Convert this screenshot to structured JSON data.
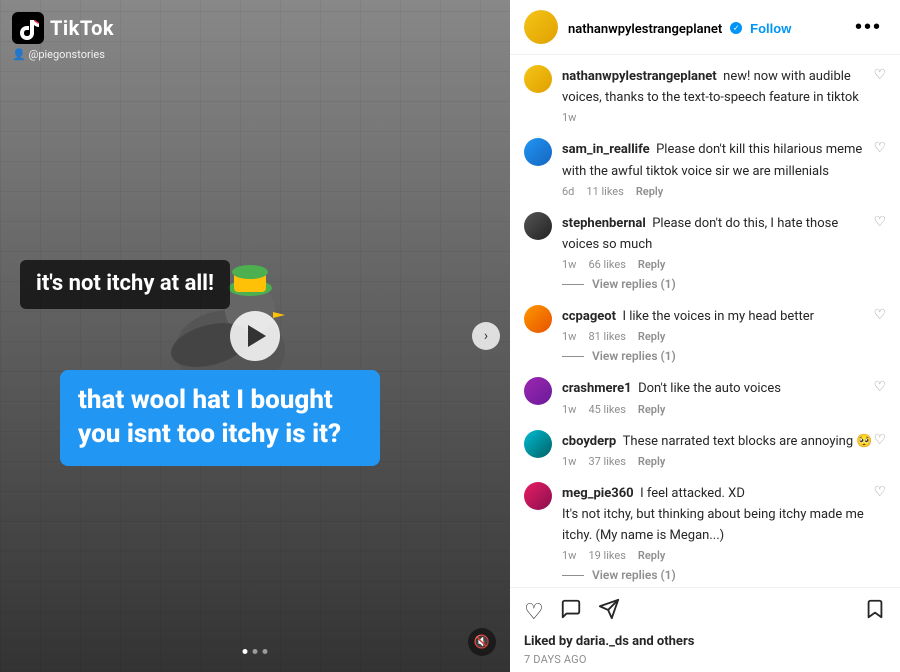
{
  "video": {
    "platform": "TikTok",
    "user": "@piegonstories",
    "caption_dark": "it's not itchy\nat all!",
    "caption_blue": "that wool hat I\nbought you isnt\ntoo itchy is it?",
    "play_button_label": "▶"
  },
  "header": {
    "username": "nathanwpylestrangeplanet",
    "verified": true,
    "follow_label": "Follow",
    "more_label": "•••"
  },
  "post_author_comment": {
    "username": "nathanwpylestrangeplanet",
    "text": "new! now with audible voices, thanks to the text-to-speech feature in tiktok",
    "time": "1w"
  },
  "comments": [
    {
      "username": "sam_in_reallife",
      "text": "Please don't kill this hilarious meme with the awful tiktok voice sir we are millenials",
      "time": "6d",
      "likes": "11 likes",
      "reply_label": "Reply",
      "has_replies": false,
      "av_class": "av-blue"
    },
    {
      "username": "stephenbernal",
      "text": "Please don't do this, I hate those voices so much",
      "time": "1w",
      "likes": "66 likes",
      "reply_label": "Reply",
      "has_replies": true,
      "replies_count": "View replies (1)",
      "av_class": "av-dark"
    },
    {
      "username": "ccpageot",
      "text": "I like the voices in my head better",
      "time": "1w",
      "likes": "81 likes",
      "reply_label": "Reply",
      "has_replies": true,
      "replies_count": "View replies (1)",
      "av_class": "av-orange"
    },
    {
      "username": "crashmere1",
      "text": "Don't like the auto voices",
      "time": "1w",
      "likes": "45 likes",
      "reply_label": "Reply",
      "has_replies": false,
      "av_class": "av-purple"
    },
    {
      "username": "cboyderp",
      "text": "These narrated text blocks are annoying 🥺",
      "time": "1w",
      "likes": "37 likes",
      "reply_label": "Reply",
      "has_replies": false,
      "av_class": "av-teal"
    },
    {
      "username": "meg_pie360",
      "text": "I feel attacked. XD\nIt's not itchy, but thinking about being itchy made me itchy. (My name is Megan...)",
      "time": "1w",
      "likes": "19 likes",
      "reply_label": "Reply",
      "has_replies": true,
      "replies_count": "View replies (1)",
      "av_class": "av-pink"
    }
  ],
  "bottom": {
    "liked_by_prefix": "Liked by ",
    "liked_by_user": "daria._ds",
    "liked_by_suffix": " and others",
    "time_ago": "7 DAYS AGO"
  },
  "icons": {
    "heart": "♡",
    "comment": "💬",
    "share": "✈",
    "bookmark": "🔖",
    "volume": "🔇",
    "play": "▶",
    "dots": "···"
  }
}
